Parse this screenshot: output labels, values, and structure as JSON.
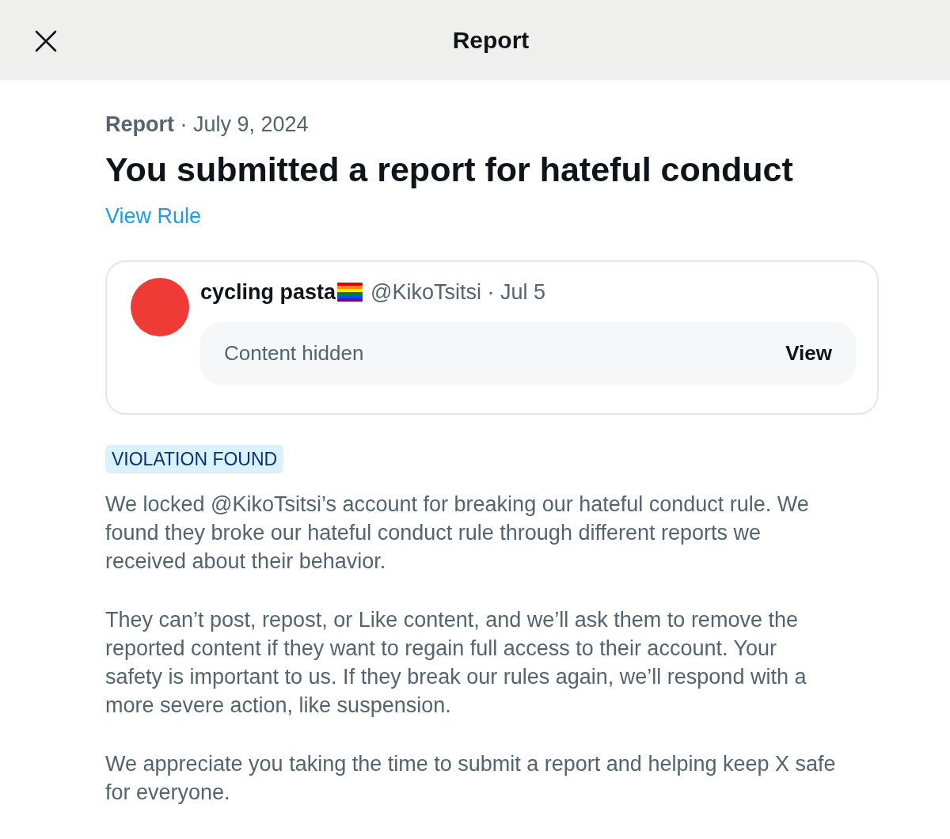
{
  "header": {
    "title": "Report"
  },
  "report": {
    "meta": "**Report** · July 9, 2024",
    "title": "You submitted a report for hateful conduct",
    "link": "View Rule"
  },
  "post": {
    "display_name": "cycling pasta",
    "meta": "@KikoTsitsi · Jul 5",
    "content_notice": "Content hidden",
    "view_button": "View"
  },
  "status_badge": "VIOLATION FOUND",
  "paragraphs": [
    "We locked @KikoTsitsi’s account for breaking our hateful conduct rule. We found they broke our hateful conduct rule through different reports we received about their behavior.",
    "They can’t post, repost, or Like content, and we’ll ask them to remove the reported content if they want to regain full access to their account. Your safety is important to us. If they break our rules again, we’ll respond with a more severe action, like suspension.",
    "We appreciate you taking the time to submit a report and helping keep X safe for everyone."
  ]
}
